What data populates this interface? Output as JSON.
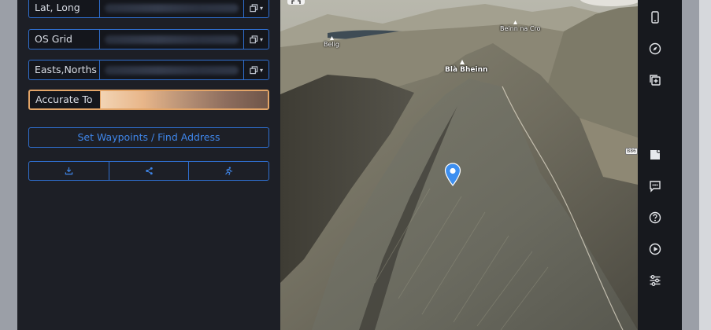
{
  "panel": {
    "rows": [
      {
        "label": "Lat, Long"
      },
      {
        "label": "OS Grid"
      },
      {
        "label": "Easts,Norths"
      },
      {
        "label": "Accurate To"
      }
    ],
    "find_button": "Set Waypoints / Find Address",
    "action_icons": [
      "download-icon",
      "share-icon",
      "running-figure-icon"
    ]
  },
  "map": {
    "labels": {
      "belig": "Belig",
      "beinn_na_cro": "Beinn na Cro",
      "bla_bheinn": "Blà Bheinn",
      "road_badge": "B86"
    },
    "marker": "location-pin-icon"
  },
  "toolbar": {
    "icons": [
      "phone-icon",
      "compass-icon",
      "add-layer-icon",
      "note-icon",
      "feedback-icon",
      "help-icon",
      "play-icon",
      "settings-sliders-icon"
    ]
  },
  "colors": {
    "panel_bg": "#1d1f26",
    "accent_blue": "#2f6fd0",
    "accent_text": "#3f86ea",
    "highlight_orange": "#e3a568",
    "toolbar_bg": "#17191e",
    "pin_blue": "#3d8ff0"
  }
}
